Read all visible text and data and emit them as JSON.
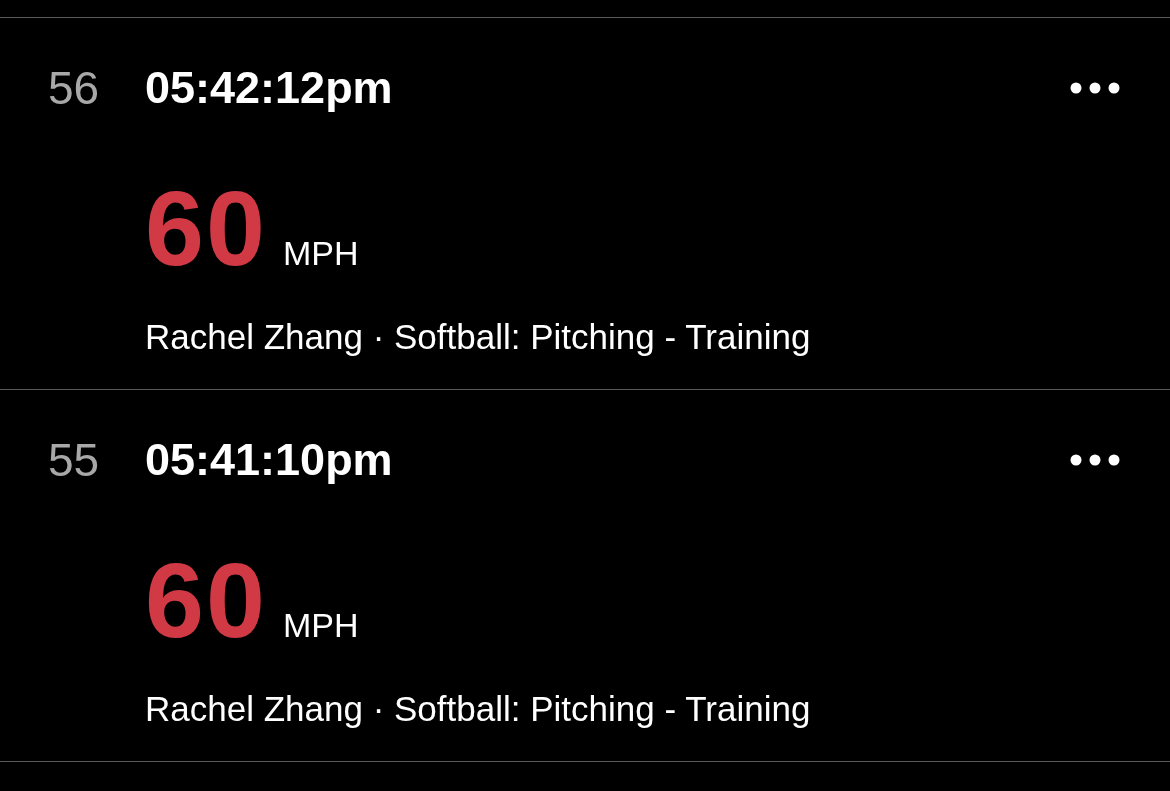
{
  "entries": [
    {
      "number": "56",
      "time": "05:42:12pm",
      "speed": "60",
      "unit": "MPH",
      "details": "Rachel Zhang · Softball: Pitching - Training"
    },
    {
      "number": "55",
      "time": "05:41:10pm",
      "speed": "60",
      "unit": "MPH",
      "details": "Rachel Zhang · Softball: Pitching - Training"
    }
  ]
}
